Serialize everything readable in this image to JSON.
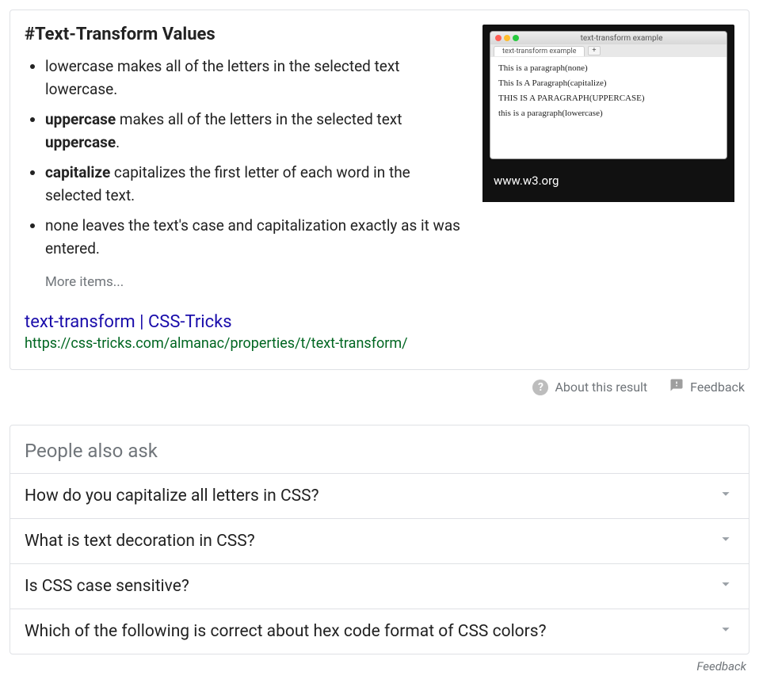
{
  "snippet": {
    "heading": "#Text-Transform Values",
    "items": [
      {
        "prefix": "lowercase",
        "prefixBold": false,
        "middle": " makes all of the letters in the selected text lowercase.",
        "boldTail": ""
      },
      {
        "prefix": "uppercase",
        "prefixBold": true,
        "middle": " makes all of the letters in the selected text ",
        "boldTail": "uppercase",
        "suffix": "."
      },
      {
        "prefix": "capitalize",
        "prefixBold": true,
        "middle": " capitalizes the first letter of each word in the selected text.",
        "boldTail": ""
      },
      {
        "prefix": "none",
        "prefixBold": false,
        "middle": " leaves the text's case and capitalization exactly as it was entered.",
        "boldTail": ""
      }
    ],
    "moreItems": "More items...",
    "sourceTitle": "text-transform | CSS-Tricks",
    "sourceUrl": "https://css-tricks.com/almanac/properties/t/text-transform/"
  },
  "thumbnail": {
    "windowTitle": "text-transform example",
    "tabLabel": "text-transform example",
    "lines": [
      "This is a paragraph(none)",
      "This Is A Paragraph(capitalize)",
      "THIS IS A PARAGRAPH(UPPERCASE)",
      "this is a paragraph(lowercase)"
    ],
    "caption": "www.w3.org"
  },
  "actions": {
    "about": "About this result",
    "feedback": "Feedback"
  },
  "paa": {
    "title": "People also ask",
    "questions": [
      "How do you capitalize all letters in CSS?",
      "What is text decoration in CSS?",
      "Is CSS case sensitive?",
      "Which of the following is correct about hex code format of CSS colors?"
    ]
  },
  "bottomFeedback": "Feedback"
}
